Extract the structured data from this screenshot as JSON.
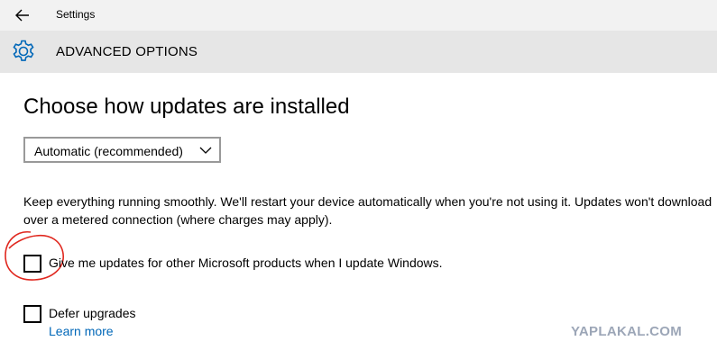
{
  "window": {
    "title": "Settings"
  },
  "header": {
    "title": "ADVANCED OPTIONS",
    "icon": "gear-icon"
  },
  "main": {
    "heading": "Choose how updates are installed",
    "dropdown": {
      "selected": "Automatic (recommended)"
    },
    "description": "Keep everything running smoothly. We'll restart your device automatically when you're not using it. Updates won't download over a metered connection (where charges may apply).",
    "options": [
      {
        "label": "Give me updates for other Microsoft products when I update Windows.",
        "checked": false
      },
      {
        "label": "Defer upgrades",
        "checked": false
      }
    ],
    "learn_more": "Learn more"
  },
  "watermark": "YAPLAKAL.COM",
  "colors": {
    "link": "#0067b8",
    "header_bg": "#e6e6e6",
    "titlebar_bg": "#f2f2f2",
    "icon": "#0067b8",
    "annotation": "#e0281f"
  }
}
